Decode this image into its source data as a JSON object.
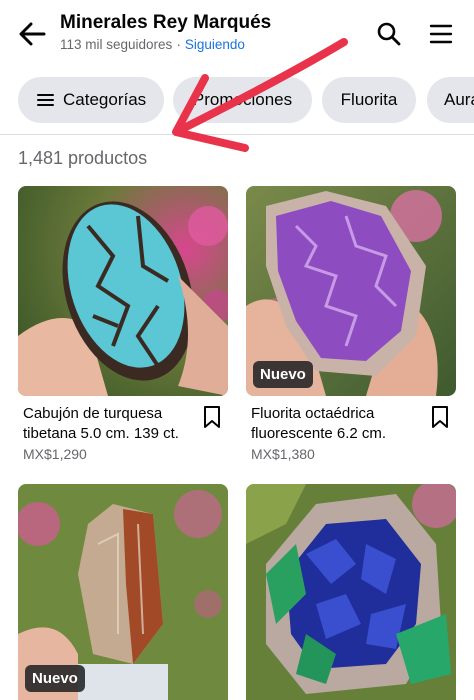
{
  "header": {
    "title": "Minerales Rey Marqués",
    "followers": "113 mil seguidores",
    "separator": "·",
    "following": "Siguiendo"
  },
  "chips": [
    {
      "label": "Categorías",
      "icon": "menu-lines-icon"
    },
    {
      "label": "Promociones"
    },
    {
      "label": "Fluorita"
    },
    {
      "label": "Aura"
    }
  ],
  "product_count": "1,481 productos",
  "products": [
    {
      "name": "Cabujón de turquesa tibetana 5.0 cm. 139 ct.",
      "price": "MX$1,290",
      "badge": ""
    },
    {
      "name": "Fluorita octaédrica fluorescente 6.2 cm.",
      "price": "MX$1,380",
      "badge": "Nuevo"
    },
    {
      "name": "",
      "price": "",
      "badge": "Nuevo"
    },
    {
      "name": "",
      "price": "",
      "badge": ""
    }
  ],
  "colors": {
    "link_blue": "#1b74e4",
    "chip_bg": "#e4e6eb",
    "secondary_text": "#65676b",
    "annotation_red": "#e8334a"
  },
  "icons": [
    "back-arrow-icon",
    "search-icon",
    "hamburger-menu-icon",
    "bookmark-icon"
  ]
}
